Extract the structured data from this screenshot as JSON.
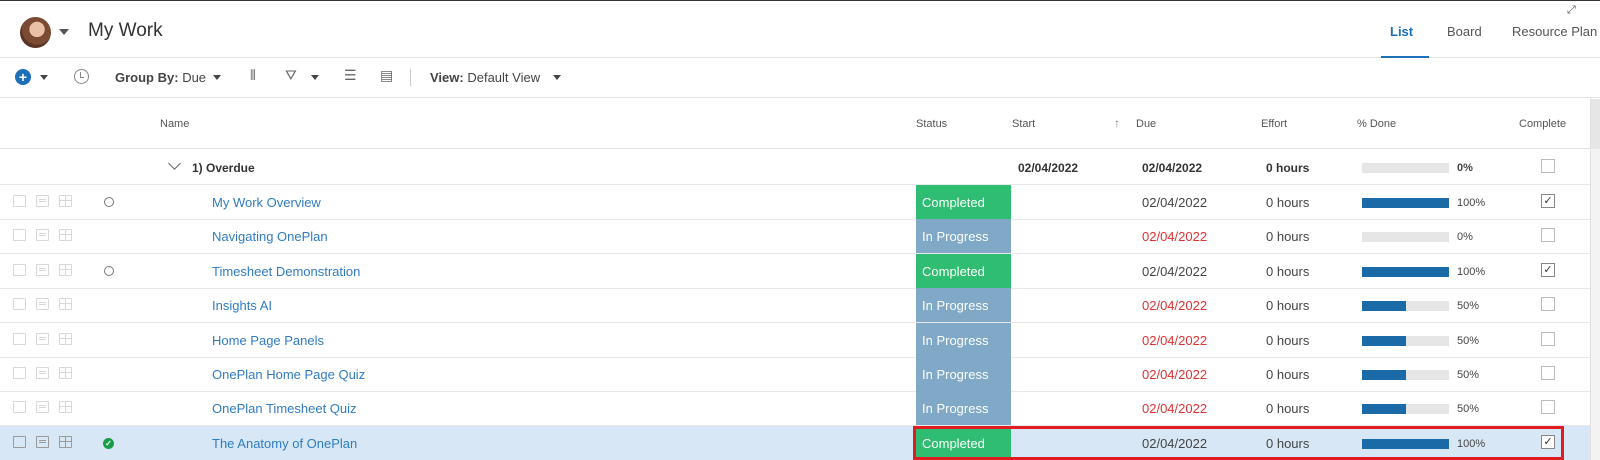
{
  "header": {
    "title": "My Work",
    "tabs": [
      {
        "label": "List",
        "active": true
      },
      {
        "label": "Board",
        "active": false
      },
      {
        "label": "Resource Plan",
        "active": false
      }
    ],
    "expand_icon": "expand-icon"
  },
  "toolbar": {
    "group_by_label": "Group By:",
    "group_by_value": "Due",
    "view_label": "View:",
    "view_value": "Default View"
  },
  "columns": {
    "name": "Name",
    "status": "Status",
    "start": "Start",
    "due": "Due",
    "effort": "Effort",
    "done": "% Done",
    "complete": "Complete"
  },
  "group": {
    "title": "1) Overdue",
    "start": "02/04/2022",
    "due": "02/04/2022",
    "effort": "0 hours",
    "pct_label": "0%",
    "progress": 0
  },
  "rows": [
    {
      "name": "My Work Overview",
      "status": "Completed",
      "due": "02/04/2022",
      "overdue": false,
      "effort": "0 hours",
      "pct_label": "100%",
      "progress": 100,
      "complete": true,
      "marker": "circle"
    },
    {
      "name": "Navigating OnePlan",
      "status": "In Progress",
      "due": "02/04/2022",
      "overdue": true,
      "effort": "0 hours",
      "pct_label": "0%",
      "progress": 0,
      "complete": false,
      "marker": "none"
    },
    {
      "name": "Timesheet Demonstration",
      "status": "Completed",
      "due": "02/04/2022",
      "overdue": false,
      "effort": "0 hours",
      "pct_label": "100%",
      "progress": 100,
      "complete": true,
      "marker": "circle"
    },
    {
      "name": "Insights AI",
      "status": "In Progress",
      "due": "02/04/2022",
      "overdue": true,
      "effort": "0 hours",
      "pct_label": "50%",
      "progress": 50,
      "complete": false,
      "marker": "none"
    },
    {
      "name": "Home Page Panels",
      "status": "In Progress",
      "due": "02/04/2022",
      "overdue": true,
      "effort": "0 hours",
      "pct_label": "50%",
      "progress": 50,
      "complete": false,
      "marker": "none"
    },
    {
      "name": "OnePlan Home Page Quiz",
      "status": "In Progress",
      "due": "02/04/2022",
      "overdue": true,
      "effort": "0 hours",
      "pct_label": "50%",
      "progress": 50,
      "complete": false,
      "marker": "none"
    },
    {
      "name": "OnePlan Timesheet Quiz",
      "status": "In Progress",
      "due": "02/04/2022",
      "overdue": true,
      "effort": "0 hours",
      "pct_label": "50%",
      "progress": 50,
      "complete": false,
      "marker": "none"
    },
    {
      "name": "The Anatomy of OnePlan",
      "status": "Completed",
      "due": "02/04/2022",
      "overdue": false,
      "effort": "0 hours",
      "pct_label": "100%",
      "progress": 100,
      "complete": true,
      "marker": "check",
      "selected": true
    }
  ],
  "colors": {
    "accent": "#1d6fb8",
    "completed": "#2ebd71",
    "in_progress": "#7fa9c6",
    "overdue": "#e03030",
    "highlight": "#e01b22"
  }
}
